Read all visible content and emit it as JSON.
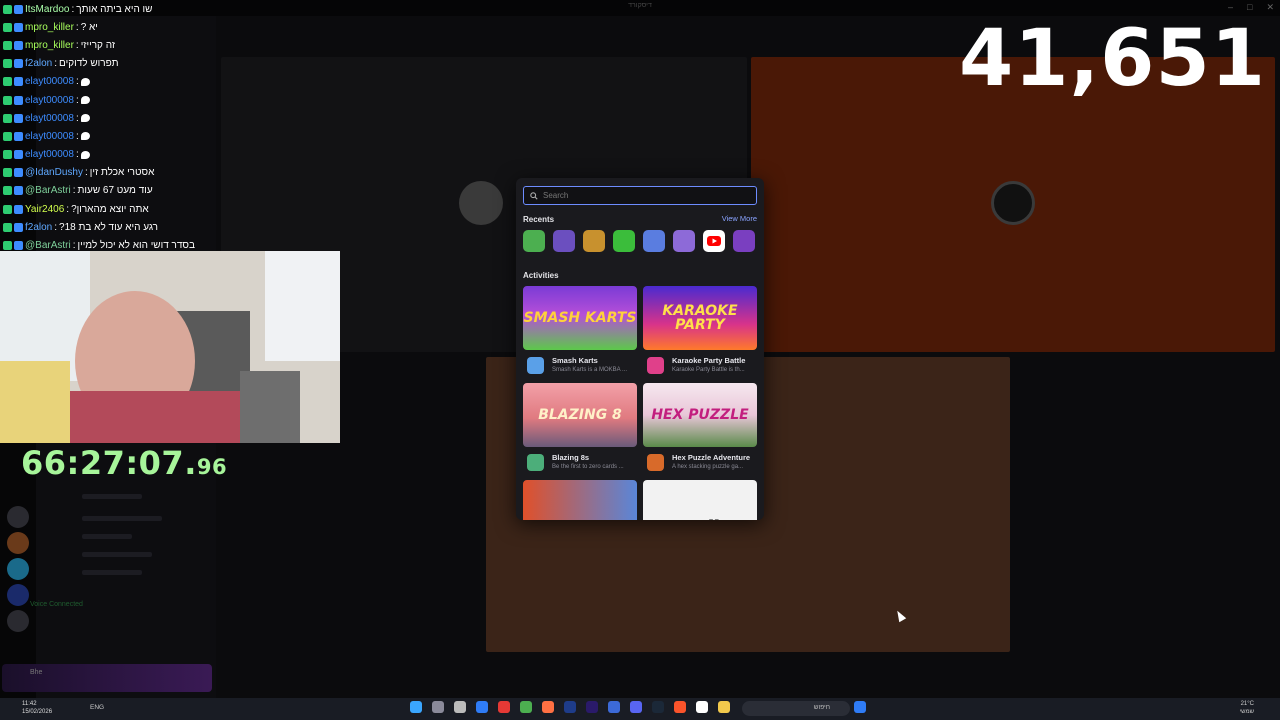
{
  "stream": {
    "counter": "41,651",
    "timer_main": "66:27:07.",
    "timer_ms": "96"
  },
  "chat": [
    {
      "user": "ItsMardoo",
      "user_color": "#aaffaa",
      "message": "שו היא ביתה אותך",
      "emote": false
    },
    {
      "user": "mpro_killer",
      "user_color": "#a8ff5c",
      "message": "יא ?",
      "emote": false
    },
    {
      "user": "mpro_killer",
      "user_color": "#a8ff5c",
      "message": "זה קרייזי",
      "emote": false
    },
    {
      "user": "f2alon",
      "user_color": "#5fa8ff",
      "message": "תפרוש לדוקים",
      "emote": false
    },
    {
      "user": "elayt00008",
      "user_color": "#3d8cff",
      "message": "",
      "emote": true
    },
    {
      "user": "elayt00008",
      "user_color": "#3d8cff",
      "message": "",
      "emote": true
    },
    {
      "user": "elayt00008",
      "user_color": "#3d8cff",
      "message": "",
      "emote": true
    },
    {
      "user": "elayt00008",
      "user_color": "#3d8cff",
      "message": "",
      "emote": true
    },
    {
      "user": "elayt00008",
      "user_color": "#3d8cff",
      "message": "",
      "emote": true
    },
    {
      "user": "@IdanDushy",
      "user_color": "#5fa8ff",
      "message": "אסטרי אכלת זין",
      "emote": false
    },
    {
      "user": "@BarAstri",
      "user_color": "#7fd19b",
      "message": "עוד מעט 67 שעות",
      "emote": false
    },
    {
      "user": "Yair2406",
      "user_color": "#d2ff4d",
      "message": "אתה יוצא מהארון?",
      "emote": false
    },
    {
      "user": "f2alon",
      "user_color": "#5fa8ff",
      "message": "רגע היא עוד לא בת 18?",
      "emote": false
    },
    {
      "user": "@BarAstri",
      "user_color": "#7fd19b",
      "message": "בסדר דושי הוא לא יכול למיין",
      "emote": false
    }
  ],
  "discord": {
    "window_title": "דיסקורד",
    "voice_status": "Voice Connected",
    "user_name": "Bhe"
  },
  "popup": {
    "search_placeholder": "Search",
    "recents_label": "Recents",
    "view_more": "View More",
    "activities_label": "Activities",
    "recents": [
      {
        "icon": "game-icon-green",
        "color": "#4caf50"
      },
      {
        "icon": "game-icon-purple",
        "color": "#6b4fbf"
      },
      {
        "icon": "game-icon-food",
        "color": "#c8912e"
      },
      {
        "icon": "game-icon-blocks",
        "color": "#3bbd3b"
      },
      {
        "icon": "game-icon-rocket",
        "color": "#5a7de0"
      },
      {
        "icon": "game-icon-star",
        "color": "#8d6ad8"
      },
      {
        "icon": "youtube-icon",
        "color": "#ffffff"
      },
      {
        "icon": "game-icon-cards",
        "color": "#7a3fc0"
      }
    ],
    "activities": [
      {
        "name": "Smash Karts",
        "desc": "Smash Karts is a MOKBA ...",
        "art_text": "SMASH KARTS",
        "bg": "linear-gradient(180deg,#7a3bd6 0%,#b64fd8 45%,#5cc94a 100%)",
        "art_color": "#ffd23a",
        "icon_color": "#5aa0e8"
      },
      {
        "name": "Karaoke Party Battle",
        "desc": "Karaoke Party Battle is th...",
        "art_text": "KARAOKE PARTY",
        "bg": "linear-gradient(180deg,#4a2ad0 0%,#d8338a 60%,#ff7a2a 100%)",
        "art_color": "#ffe04a",
        "icon_color": "#e0408a"
      },
      {
        "name": "Blazing 8s",
        "desc": "Be the first to zero cards ...",
        "art_text": "BLAZING 8",
        "bg": "linear-gradient(180deg,#f2a0a8 0%,#e07a80 55%,#6a5a7a 100%)",
        "art_color": "#fff1c8",
        "icon_color": "#4cae7a"
      },
      {
        "name": "Hex Puzzle Adventure",
        "desc": "A hex stacking puzzle ga...",
        "art_text": "HEX PUZZLE",
        "bg": "linear-gradient(180deg,#f6e8ef 0%,#e9c6d8 50%,#5a8a4a 100%)",
        "art_color": "#c21e7e",
        "icon_color": "#d86a2a"
      },
      {
        "name": "",
        "desc": "",
        "art_text": "",
        "bg": "linear-gradient(90deg,#e0502a 0%,#5a86d8 100%)",
        "art_color": "#ffffff",
        "icon_color": "#333333"
      },
      {
        "name": "",
        "desc": "",
        "art_text": "Wordle",
        "bg": "#f2f2f2",
        "art_color": "#111111",
        "icon_color": "#333333"
      }
    ]
  },
  "taskbar": {
    "time": "11:42",
    "date": "15/02/2026",
    "language": "ENG",
    "search_label": "חיפוש",
    "temperature": "21°C",
    "weather": "שמשי"
  }
}
